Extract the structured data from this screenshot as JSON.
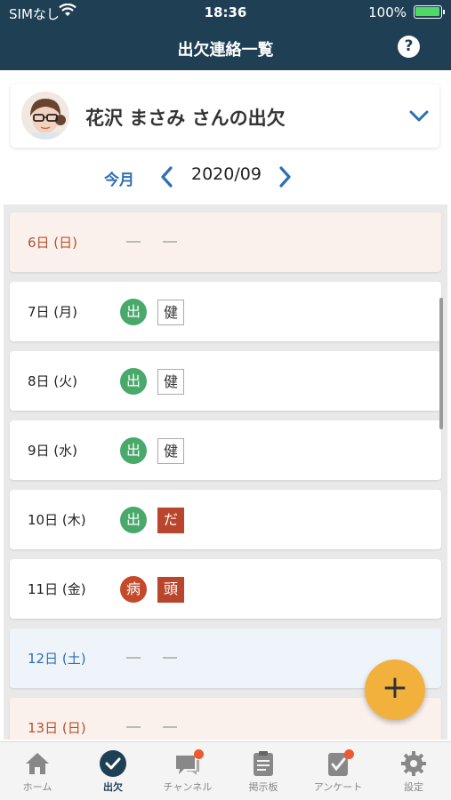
{
  "status_bar": {
    "carrier": "SIMなし",
    "time": "18:36",
    "battery": "100%"
  },
  "header": {
    "title": "出欠連絡一覧",
    "help": "?"
  },
  "student": {
    "name": "花沢 まさみ さんの出欠"
  },
  "month_nav": {
    "this_month": "今月",
    "current": "2020/09"
  },
  "days": [
    {
      "date": "6日 (日)",
      "type": "sun",
      "status": null,
      "reason": null
    },
    {
      "date": "7日 (月)",
      "type": "weekday",
      "status": "出",
      "status_color": "#48a96a",
      "reason": "健",
      "reason_style": "outline"
    },
    {
      "date": "8日 (火)",
      "type": "weekday",
      "status": "出",
      "status_color": "#48a96a",
      "reason": "健",
      "reason_style": "outline"
    },
    {
      "date": "9日 (水)",
      "type": "weekday",
      "status": "出",
      "status_color": "#48a96a",
      "reason": "健",
      "reason_style": "outline"
    },
    {
      "date": "10日 (木)",
      "type": "weekday",
      "status": "出",
      "status_color": "#48a96a",
      "reason": "だ",
      "reason_style": "filled"
    },
    {
      "date": "11日 (金)",
      "type": "weekday",
      "status": "病",
      "status_color": "#c44a2a",
      "reason": "頭",
      "reason_style": "filled"
    },
    {
      "date": "12日 (土)",
      "type": "sat",
      "status": null,
      "reason": null
    },
    {
      "date": "13日 (日)",
      "type": "sun",
      "status": null,
      "reason": null
    }
  ],
  "fab": {
    "label": "+"
  },
  "tabs": [
    {
      "label": "ホーム",
      "icon": "home-icon"
    },
    {
      "label": "出欠",
      "icon": "check-circle-icon",
      "active": true
    },
    {
      "label": "チャンネル",
      "icon": "chat-icon",
      "badge": true
    },
    {
      "label": "掲示板",
      "icon": "clipboard-icon"
    },
    {
      "label": "アンケート",
      "icon": "survey-icon",
      "badge": true
    },
    {
      "label": "設定",
      "icon": "gear-icon"
    }
  ],
  "colors": {
    "header_bg": "#1f3f55",
    "accent": "#2d6fb3",
    "present": "#48a96a",
    "sick": "#c44a2a",
    "fab": "#f2b13d"
  }
}
